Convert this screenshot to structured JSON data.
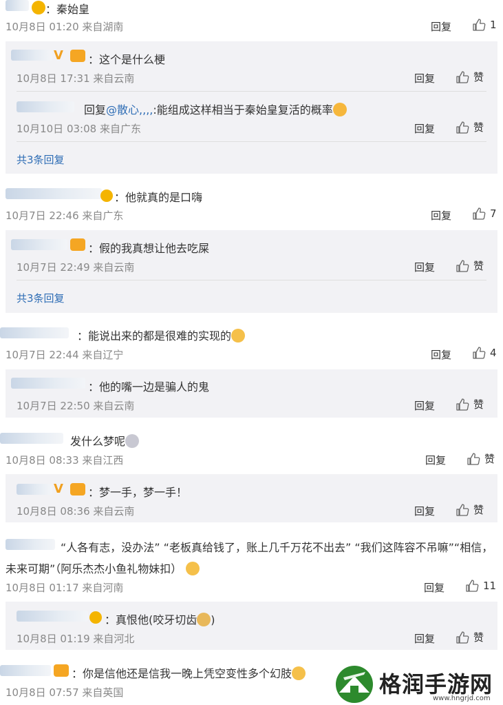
{
  "comments": [
    {
      "text": "：秦始皇",
      "time": "10月8日 01:20 来自湖南",
      "reply": "回复",
      "likes": "1",
      "sub": [
        {
          "text": "：这个是什么梗",
          "time": "10月8日 17:31 来自云南",
          "reply": "回复",
          "likes": "赞"
        },
        {
          "text_prefix": "回复",
          "mention": "@散心,,,,",
          "text": ":能组成这样相当于秦始皇复活的概率",
          "time": "10月10日 03:08 来自广东",
          "reply": "回复",
          "likes": "赞"
        }
      ],
      "more": "共3条回复"
    },
    {
      "text": "：他就真的是口嗨",
      "time": "10月7日 22:46 来自广东",
      "reply": "回复",
      "likes": "7",
      "sub": [
        {
          "text": "：假的我真想让他去吃屎",
          "time": "10月7日 22:49 来自云南",
          "reply": "回复",
          "likes": "赞"
        }
      ],
      "more": "共3条回复"
    },
    {
      "text": "：能说出来的都是很难的实现的",
      "time": "10月7日 22:44 来自辽宁",
      "reply": "回复",
      "likes": "4",
      "sub": [
        {
          "text": "：他的嘴一边是骗人的鬼",
          "time": "10月7日 22:50 来自云南",
          "reply": "回复",
          "likes": "赞"
        }
      ]
    },
    {
      "text": "发什么梦呢",
      "time": "10月8日 08:33 来自江西",
      "reply": "回复",
      "likes": "赞",
      "sub": [
        {
          "text": "：梦一手，梦一手！",
          "time": "10月8日 08:36 来自云南",
          "reply": "回复",
          "likes": "赞"
        }
      ]
    },
    {
      "text_line1": "“人各有志，没办法” “老板真给钱了，账上几千万花不出去” “我们这阵容不吊嘛”“相信，",
      "text_line2": "未来可期”（阿乐杰杰小鱼礼物妹扣）",
      "time": "10月8日 01:17 来自河南",
      "reply": "回复",
      "likes": "11",
      "sub": [
        {
          "text": "：真恨他(咬牙切齿",
          "text_suffix": ")",
          "time": "10月8日 01:19 来自河北",
          "reply": "回复",
          "likes": "赞"
        }
      ]
    },
    {
      "text": "：你是信他还是信我一晚上凭空变性多个幻肢",
      "time": "10月8日 07:57 来自英国"
    }
  ],
  "watermark": {
    "title": "格润手游网",
    "url": "www.hngrjd.com"
  },
  "colors": {
    "accent": "#2e6db5",
    "panel": "#f2f2f5",
    "meta": "#888888",
    "watermark_green": "#2d8a2d"
  },
  "icons": [
    "thumbs-up-icon",
    "emoji-icon",
    "crown-badge-icon",
    "vip-badge-icon"
  ]
}
